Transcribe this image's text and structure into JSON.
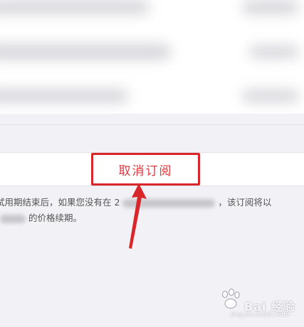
{
  "cancel_subscription": {
    "label": "取消订阅"
  },
  "info": {
    "line1_prefix": "试用期结束后，如果您没有在",
    "line1_partial": "2",
    "line1_suffix": "，该订阅将以",
    "line2_suffix": "的价格续期。"
  },
  "watermark": {
    "brand": "Bai 经验",
    "site": "jingyan.baidu.com"
  },
  "colors": {
    "highlight_box": "#d9262a",
    "arrow": "#d9262a",
    "cancel_text": "#e0363b",
    "background": "#f2f2f6"
  },
  "icons": {
    "arrow": "arrow-up-icon",
    "paw": "baidu-paw-icon"
  }
}
